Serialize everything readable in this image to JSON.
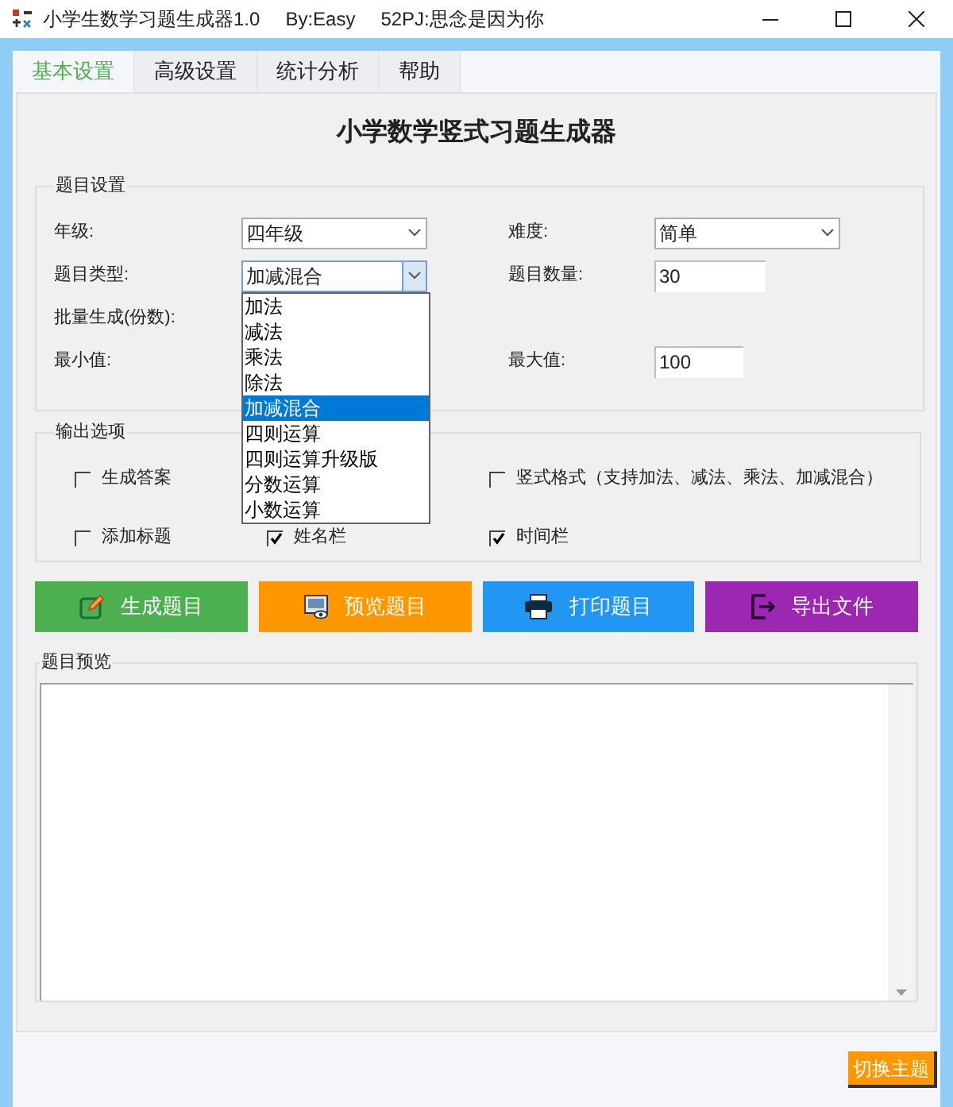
{
  "window": {
    "title": "小学生数学习题生成器1.0",
    "author": "By:Easy",
    "credit": "52PJ:思念是因为你"
  },
  "tabs": [
    {
      "label": "基本设置",
      "selected": true
    },
    {
      "label": "高级设置",
      "selected": false
    },
    {
      "label": "统计分析",
      "selected": false
    },
    {
      "label": "帮助",
      "selected": false
    }
  ],
  "heading": "小学数学竖式习题生成器",
  "settings": {
    "title": "题目设置",
    "rows": [
      {
        "left": {
          "label": "年级:",
          "kind": "combo",
          "value": "四年级",
          "expanded": false
        },
        "right": {
          "label": "难度:",
          "kind": "combo",
          "value": "简单",
          "expanded": false
        }
      },
      {
        "left": {
          "label": "题目类型:",
          "kind": "combo",
          "value": "加减混合",
          "expanded": true,
          "options": [
            {
              "label": "加法",
              "selected": false
            },
            {
              "label": "减法",
              "selected": false
            },
            {
              "label": "乘法",
              "selected": false
            },
            {
              "label": "除法",
              "selected": false
            },
            {
              "label": "加减混合",
              "selected": true
            },
            {
              "label": "四则运算",
              "selected": false
            },
            {
              "label": "四则运算升级版",
              "selected": false
            },
            {
              "label": "分数运算",
              "selected": false
            },
            {
              "label": "小数运算",
              "selected": false
            }
          ]
        },
        "right": {
          "label": "题目数量:",
          "kind": "input",
          "value": "30"
        }
      },
      {
        "left": {
          "label": "批量生成(份数):",
          "kind": "hidden"
        },
        "right": null
      },
      {
        "left": {
          "label": "最小值:",
          "kind": "hidden"
        },
        "right": {
          "label": "最大值:",
          "kind": "input",
          "value": "100"
        }
      }
    ]
  },
  "output": {
    "title": "输出选项",
    "rows": [
      [
        {
          "label": "生成答案",
          "checked": false
        },
        null,
        {
          "label": "竖式格式（支持加法、减法、乘法、加减混合）",
          "checked": false
        }
      ],
      [
        {
          "label": "添加标题",
          "checked": false
        },
        {
          "label": "姓名栏",
          "checked": true
        },
        {
          "label": "时间栏",
          "checked": true
        }
      ]
    ]
  },
  "actions": [
    {
      "label": "生成题目",
      "kind": "edit",
      "color": "#4caf50"
    },
    {
      "label": "预览题目",
      "kind": "preview",
      "color": "#ff9800"
    },
    {
      "label": "打印题目",
      "kind": "print",
      "color": "#2196f3"
    },
    {
      "label": "导出文件",
      "kind": "export",
      "color": "#9c27b0"
    }
  ],
  "preview": {
    "title": "题目预览"
  },
  "theme_button": "切换主题"
}
